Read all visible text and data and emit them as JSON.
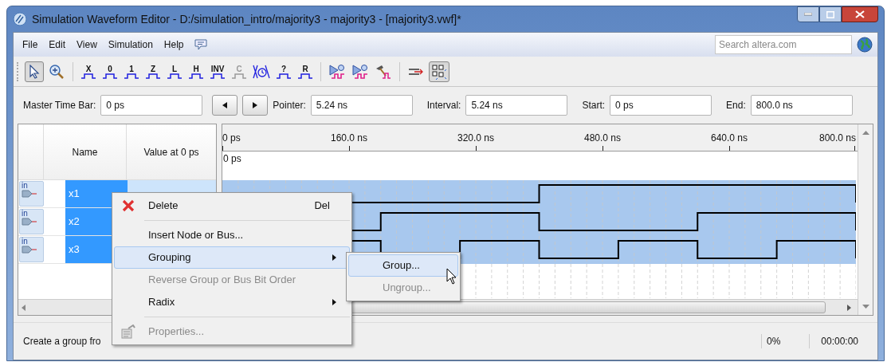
{
  "window": {
    "title": "Simulation Waveform Editor - D:/simulation_intro/majority3 - majority3 - [majority3.vwf]*"
  },
  "menu": [
    "File",
    "Edit",
    "View",
    "Simulation",
    "Help"
  ],
  "search": {
    "placeholder": "Search altera.com"
  },
  "toolbar": [
    {
      "kind": "pointer",
      "selected": true
    },
    {
      "kind": "zoom",
      "selected": false
    },
    {
      "kind": "separator"
    },
    {
      "kind": "wave",
      "glyph": "X",
      "disabled": false
    },
    {
      "kind": "wave",
      "glyph": "0",
      "disabled": false
    },
    {
      "kind": "wave",
      "glyph": "1",
      "disabled": false
    },
    {
      "kind": "wave",
      "glyph": "Z",
      "disabled": false
    },
    {
      "kind": "wave",
      "glyph": "L",
      "disabled": false
    },
    {
      "kind": "wave",
      "glyph": "H",
      "disabled": false
    },
    {
      "kind": "wave",
      "glyph": "INV",
      "disabled": false
    },
    {
      "kind": "wave",
      "glyph": "C",
      "disabled": true
    },
    {
      "kind": "clock"
    },
    {
      "kind": "wave",
      "glyph": "?",
      "disabled": false
    },
    {
      "kind": "wave",
      "glyph": "R",
      "disabled": false
    },
    {
      "kind": "separator"
    },
    {
      "kind": "sim"
    },
    {
      "kind": "sim"
    },
    {
      "kind": "hammer"
    },
    {
      "kind": "separator"
    },
    {
      "kind": "snap",
      "selected": false
    },
    {
      "kind": "grid",
      "selected": true
    }
  ],
  "timebar": {
    "master_label": "Master Time Bar:",
    "master_value": "0 ps",
    "pointer_label": "Pointer:",
    "pointer_value": "5.24 ns",
    "interval_label": "Interval:",
    "interval_value": "5.24 ns",
    "start_label": "Start:",
    "start_value": "0 ps",
    "end_label": "End:",
    "end_value": "800.0 ns"
  },
  "table": {
    "columns": [
      "Name",
      "Value at 0 ps"
    ],
    "rows": [
      {
        "direction": "in",
        "name": "x1",
        "selected": true
      },
      {
        "direction": "in",
        "name": "x2",
        "selected": true
      },
      {
        "direction": "in",
        "name": "x3",
        "selected": true
      }
    ]
  },
  "ruler": {
    "labels": [
      "0 ps",
      "160.0 ns",
      "320.0 ns",
      "480.0 ns",
      "640.0 ns",
      "800.0 ns"
    ],
    "marker": "0 ps"
  },
  "context_menu": [
    {
      "kind": "delete",
      "label": "Delete",
      "shortcut": "Del",
      "disabled": false,
      "selected": false
    },
    {
      "kind": "separator"
    },
    {
      "kind": "item",
      "label": "Insert Node or Bus...",
      "disabled": false,
      "selected": false
    },
    {
      "kind": "submenu",
      "label": "Grouping",
      "disabled": false,
      "selected": true
    },
    {
      "kind": "item",
      "label": "Reverse Group or Bus Bit Order",
      "disabled": true,
      "selected": false
    },
    {
      "kind": "submenu",
      "label": "Radix",
      "disabled": false,
      "selected": false
    },
    {
      "kind": "separator"
    },
    {
      "kind": "properties",
      "label": "Properties...",
      "disabled": true,
      "selected": false
    }
  ],
  "submenu": [
    {
      "label": "Group...",
      "disabled": false,
      "selected": true
    },
    {
      "label": "Ungroup...",
      "disabled": true,
      "selected": false
    }
  ],
  "status_bar": {
    "message": "Create a group fro",
    "progress": "0%",
    "elapsed": "00:00:00"
  }
}
